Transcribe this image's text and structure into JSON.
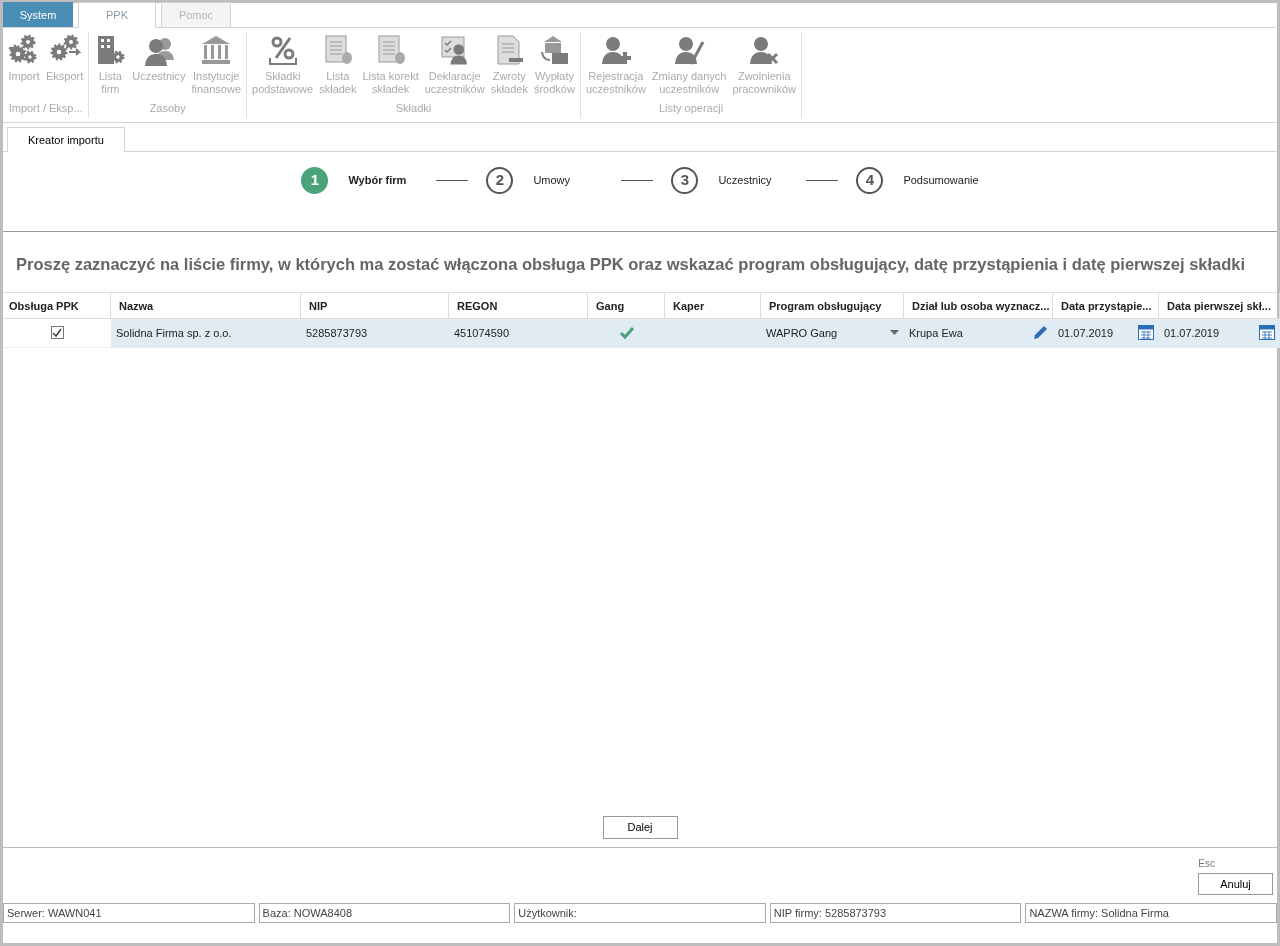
{
  "ribbon_tabs": [
    {
      "label": "System",
      "kind": "app",
      "selected": false
    },
    {
      "label": "PPK",
      "kind": "tab",
      "selected": true
    },
    {
      "label": "Pomoc",
      "kind": "tab",
      "selected": false
    }
  ],
  "ribbon_groups": [
    {
      "label": "Import / Eksp...",
      "buttons": [
        "Import",
        "Eksport"
      ]
    },
    {
      "label": "Zasoby",
      "buttons": [
        "Lista\nfirm",
        "Uczestnicy",
        "Instytucje\nfinansowe"
      ]
    },
    {
      "label": "Składki",
      "buttons": [
        "Składki\npodstawowe",
        "Lista\nskładek",
        "Lista korekt\nskładek",
        "Deklaracje\nuczestników",
        "Zwroty\nskładek",
        "Wypłaty\nśrodków"
      ]
    },
    {
      "label": "Listy operacji",
      "buttons": [
        "Rejestracja\nuczestników",
        "Zmiany danych\nuczestników",
        "Zwolnienia\npracowników"
      ]
    }
  ],
  "document_tabs": [
    {
      "label": "Kreator importu",
      "selected": true
    }
  ],
  "wizard_steps": [
    {
      "number": "1",
      "label": "Wybór firm",
      "active": true
    },
    {
      "number": "2",
      "label": "Umowy",
      "active": false
    },
    {
      "number": "3",
      "label": "Uczestnicy",
      "active": false
    },
    {
      "number": "4",
      "label": "Podsumowanie",
      "active": false
    }
  ],
  "instruction": "Proszę zaznaczyć na liście firmy, w których ma zostać włączona obsługa PPK oraz wskazać program obsługujący, datę przystąpienia i datę pierwszej składki",
  "table": {
    "columns": [
      "Obsługa PPK",
      "Nazwa",
      "NIP",
      "REGON",
      "Gang",
      "Kaper",
      "Program obsługujący",
      "Dział lub osoba wyznacz...",
      "Data przystąpie...",
      "Data pierwszej skł..."
    ],
    "rows": [
      {
        "selected": true,
        "obsluga_ppk": true,
        "nazwa": "Solidna Firma sp. z o.o.",
        "nip": "5285873793",
        "regon": "451074590",
        "gang": true,
        "program": "WAPRO Gang",
        "dzial": "Krupa Ewa",
        "data_przystapienia": "01.07.2019",
        "data_pierwszej_skladki": "01.07.2019"
      }
    ]
  },
  "next_button": "Dalej",
  "shortcut_hint": "Esc",
  "cancel_button": "Anuluj",
  "status_bar": [
    "Serwer: WAWN041",
    "Baza: NOWA8408",
    "Użytkownik:",
    "NIP firmy: 5285873793",
    "NAZWA firmy: Solidna Firma"
  ]
}
